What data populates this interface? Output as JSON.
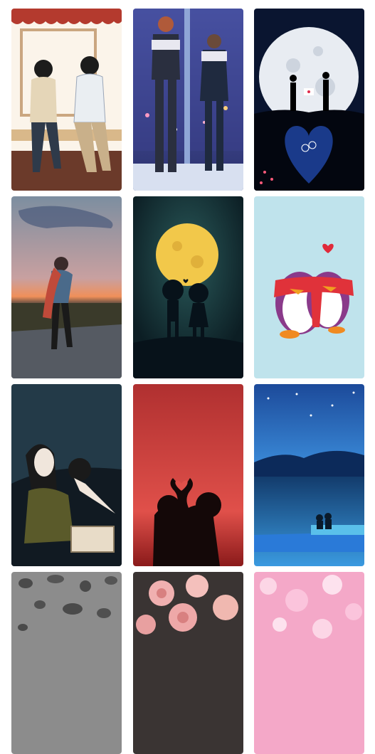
{
  "gallery": {
    "items": [
      {
        "icon": "couple-on-bench-icon",
        "bg": "#fbf4ea"
      },
      {
        "icon": "couple-by-window-icon",
        "bg": "#3d4a8c"
      },
      {
        "icon": "moon-couple-silhouette-icon",
        "bg": "#0a1a3a"
      },
      {
        "icon": "couple-embrace-sunset-icon",
        "bg": "#8c9aa8"
      },
      {
        "icon": "full-moon-kids-silhouette-icon",
        "bg": "#0f2a33"
      },
      {
        "icon": "penguins-scarf-heart-icon",
        "bg": "#bfe4ee"
      },
      {
        "icon": "couple-in-car-icon",
        "bg": "#243a48"
      },
      {
        "icon": "heart-hands-silhouette-icon",
        "bg": "#9e2a2a"
      },
      {
        "icon": "couple-on-pier-night-icon",
        "bg": "#1c4fa0"
      },
      {
        "icon": "water-drops-icon",
        "bg": "#8a8a8a"
      },
      {
        "icon": "pink-roses-icon",
        "bg": "#3a3433"
      },
      {
        "icon": "pink-bokeh-icon",
        "bg": "#f2a8c8"
      }
    ]
  }
}
